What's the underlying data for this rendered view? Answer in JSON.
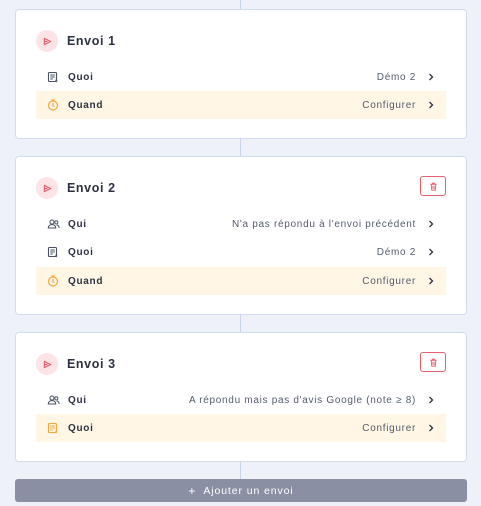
{
  "colors": {
    "accent": "#e5616e",
    "badge_bg": "#fbe3e6",
    "highlight_bg": "#fff6e5",
    "clock_icon": "#f0a73c",
    "add_button_bg": "#8a8fa3"
  },
  "envois": [
    {
      "title": "Envoi 1",
      "rows": [
        {
          "icon": "message-form-icon",
          "label": "Quoi",
          "value": "Démo 2"
        },
        {
          "icon": "clock-icon",
          "label": "Quand",
          "value": "Configurer"
        }
      ]
    },
    {
      "title": "Envoi 2",
      "rows": [
        {
          "icon": "users-icon",
          "label": "Qui",
          "value": "N'a pas répondu à l'envoi précédent"
        },
        {
          "icon": "message-form-icon",
          "label": "Quoi",
          "value": "Démo 2"
        },
        {
          "icon": "clock-icon",
          "label": "Quand",
          "value": "Configurer"
        }
      ]
    },
    {
      "title": "Envoi 3",
      "rows": [
        {
          "icon": "users-icon",
          "label": "Qui",
          "value": "A répondu mais pas d'avis Google (note ≥ 8)"
        },
        {
          "icon": "message-form-icon",
          "label": "Quoi",
          "value": "Configurer"
        }
      ]
    }
  ],
  "add_button": {
    "label": "Ajouter un envoi",
    "icon": "plus-icon"
  }
}
